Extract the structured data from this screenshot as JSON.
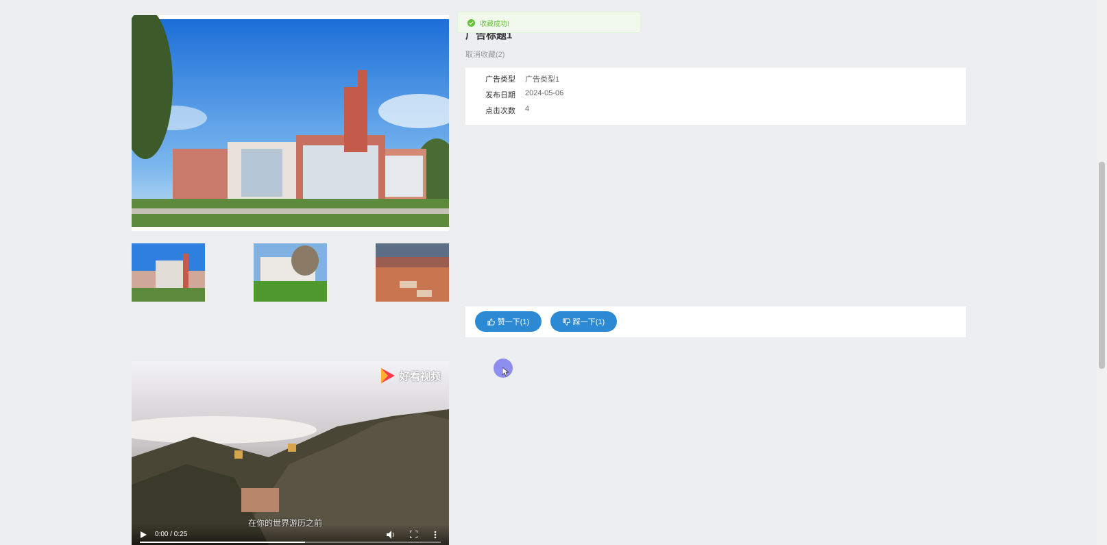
{
  "ad": {
    "title": "广告标题1",
    "uncollect_label": "取消收藏(2)",
    "info": [
      {
        "label": "广告类型",
        "value": "广告类型1"
      },
      {
        "label": "发布日期",
        "value": "2024-05-06"
      },
      {
        "label": "点击次数",
        "value": "4"
      }
    ]
  },
  "votes": {
    "like_label": "赞一下(1)",
    "dislike_label": "踩一下(1)"
  },
  "toast": {
    "message": "收藏成功!",
    "color": "#67c23a"
  },
  "video": {
    "logo_text": "好看视频",
    "subtitle": "在你的世界游历之前",
    "time": "0:00 / 0:25",
    "progress": 0.55
  },
  "theme": {
    "accent": "#2b8ad3",
    "background": "#edeef0"
  },
  "icons": {
    "like": "thumbs-up-icon",
    "dislike": "thumbs-down-icon",
    "success": "check-circle-icon",
    "play": "play-icon",
    "volume": "volume-icon",
    "fullscreen": "fullscreen-icon",
    "more": "more-vertical-icon"
  }
}
